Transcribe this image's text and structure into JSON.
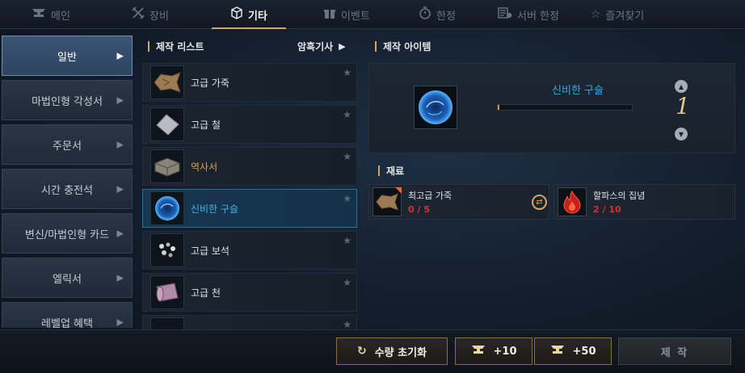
{
  "top_tabs": [
    {
      "label": "메인",
      "icon": "anvil-icon"
    },
    {
      "label": "장비",
      "icon": "crossed-swords-icon"
    },
    {
      "label": "기타",
      "icon": "cube-icon",
      "active": true
    },
    {
      "label": "이벤트",
      "icon": "gift-icon"
    },
    {
      "label": "한정",
      "icon": "stopwatch-icon"
    },
    {
      "label": "서버 한정",
      "icon": "server-timer-icon"
    },
    {
      "label": "즐겨찾기",
      "icon": "star-icon"
    }
  ],
  "categories": [
    {
      "label": "일반",
      "active": true
    },
    {
      "label": "마법인형 각성서"
    },
    {
      "label": "주문서"
    },
    {
      "label": "시간 충전석"
    },
    {
      "label": "변신/마법인형 카드"
    },
    {
      "label": "엘릭서"
    },
    {
      "label": "레벨업 혜택"
    }
  ],
  "craft_list": {
    "heading": "제작 리스트",
    "filter_label": "암흑기사",
    "items": [
      {
        "name": "고급 가죽",
        "icon": "leather-hide-icon"
      },
      {
        "name": "고급 철",
        "icon": "iron-plate-icon"
      },
      {
        "name": "역사서",
        "icon": "book-icon",
        "color": "gold"
      },
      {
        "name": "신비한 구슬",
        "icon": "mystic-orb-icon",
        "color": "blue",
        "selected": true
      },
      {
        "name": "고급 보석",
        "icon": "gems-icon"
      },
      {
        "name": "고급 천",
        "icon": "cloth-roll-icon"
      },
      {
        "name": "",
        "icon": "partial-item-icon"
      }
    ]
  },
  "craft_item": {
    "heading": "제작 아이템",
    "name": "신비한 구슬",
    "quantity": "1",
    "progress": 0.01
  },
  "materials": {
    "heading": "재료",
    "items": [
      {
        "name": "최고급 가죽",
        "count": "0 / 5",
        "icon": "leather-hide-icon"
      },
      {
        "name": "할파스의 집념",
        "count": "2 / 10",
        "icon": "red-flame-icon"
      }
    ]
  },
  "buttons": {
    "reset": "수량 초기화",
    "plus10": "+10",
    "plus50": "+50",
    "craft": "제 작"
  },
  "colors": {
    "accent_gold": "#d3a65b",
    "selected_blue": "#45b0e6",
    "count_red": "#d8302b"
  }
}
